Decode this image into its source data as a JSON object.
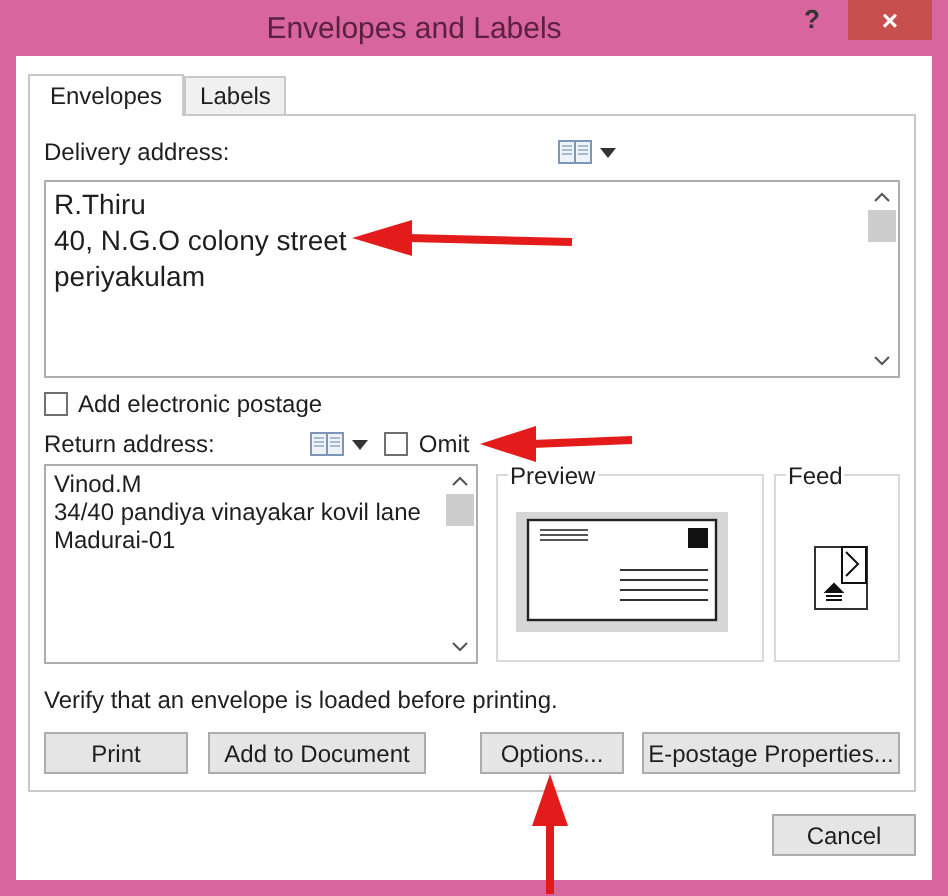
{
  "window": {
    "title": "Envelopes and Labels",
    "help": "?",
    "close": "×"
  },
  "tabs": [
    {
      "label": "Envelopes",
      "selected": true
    },
    {
      "label": "Labels",
      "selected": false
    }
  ],
  "delivery": {
    "label": "Delivery address:",
    "lines": [
      "R.Thiru",
      "40, N.G.O colony street",
      "periyakulam"
    ]
  },
  "electronic_postage": {
    "label": "Add electronic postage",
    "checked": false
  },
  "return_address": {
    "label": "Return address:",
    "omit": {
      "label": "Omit",
      "checked": false
    },
    "lines": [
      "Vinod.M",
      "34/40 pandiya vinayakar kovil lane",
      "Madurai-01"
    ]
  },
  "preview": {
    "title": "Preview"
  },
  "feed": {
    "title": "Feed"
  },
  "note": "Verify that an envelope is loaded before printing.",
  "buttons": [
    "Print",
    "Add to Document",
    "Options...",
    "E-postage Properties..."
  ],
  "cancel": "Cancel"
}
